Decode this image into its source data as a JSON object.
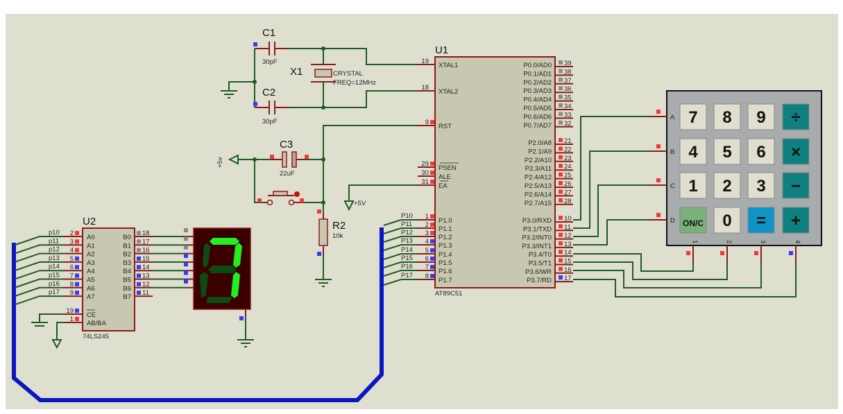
{
  "colors": {
    "background": "#dfdfd0",
    "wire": "#1f5c1f",
    "pin": "#8b1a1a",
    "bus": "#0a16c0",
    "high": "#f03a3a",
    "low": "#3a3af5",
    "float": "#8a8a8a",
    "segment_on": "#22ee22",
    "segment_off": "#0f4a12",
    "display_bg": "#3a0000"
  },
  "u1": {
    "ref": "U1",
    "part": "AT89C51",
    "left_pins": [
      {
        "name": "XTAL1",
        "num": "19",
        "state": ""
      },
      {
        "name": "XTAL2",
        "num": "18",
        "state": ""
      },
      {
        "name": "RST",
        "num": "9",
        "state": "high"
      },
      {
        "name": "PSEN",
        "num": "29",
        "state": "high"
      },
      {
        "name": "ALE",
        "num": "30",
        "state": "high"
      },
      {
        "name": "EA",
        "num": "31",
        "state": "high"
      },
      {
        "name": "P1.0",
        "num": "1",
        "state": "high",
        "net": "P10"
      },
      {
        "name": "P1.1",
        "num": "2",
        "state": "high",
        "net": "P11"
      },
      {
        "name": "P1.2",
        "num": "3",
        "state": "high",
        "net": "P12"
      },
      {
        "name": "P1.3",
        "num": "4",
        "state": "low",
        "net": "P13"
      },
      {
        "name": "P1.4",
        "num": "5",
        "state": "low",
        "net": "P14"
      },
      {
        "name": "P1.5",
        "num": "6",
        "state": "low",
        "net": "P15"
      },
      {
        "name": "P1.6",
        "num": "7",
        "state": "low",
        "net": "P16"
      },
      {
        "name": "P1.7",
        "num": "8",
        "state": "low",
        "net": "P17"
      }
    ],
    "right_pins": [
      {
        "name": "P0.0/AD0",
        "num": "39",
        "state": "float"
      },
      {
        "name": "P0.1/AD1",
        "num": "38",
        "state": "float"
      },
      {
        "name": "P0.2/AD2",
        "num": "37",
        "state": "float"
      },
      {
        "name": "P0.3/AD3",
        "num": "36",
        "state": "float"
      },
      {
        "name": "P0.4/AD4",
        "num": "35",
        "state": "float"
      },
      {
        "name": "P0.5/AD5",
        "num": "34",
        "state": "float"
      },
      {
        "name": "P0.6/AD6",
        "num": "33",
        "state": "float"
      },
      {
        "name": "P0.7/AD7",
        "num": "32",
        "state": "float"
      },
      {
        "name": "P2.0/A8",
        "num": "21",
        "state": "high"
      },
      {
        "name": "P2.1/A9",
        "num": "22",
        "state": "high"
      },
      {
        "name": "P2.2/A10",
        "num": "23",
        "state": "high"
      },
      {
        "name": "P2.3/A11",
        "num": "24",
        "state": "high"
      },
      {
        "name": "P2.4/A12",
        "num": "25",
        "state": "high"
      },
      {
        "name": "P2.5/A13",
        "num": "26",
        "state": "high"
      },
      {
        "name": "P2.6/A14",
        "num": "27",
        "state": "high"
      },
      {
        "name": "P2.7/A15",
        "num": "28",
        "state": "high"
      },
      {
        "name": "P3.0/RXD",
        "num": "10",
        "state": "high"
      },
      {
        "name": "P3.1/TXD",
        "num": "11",
        "state": "high"
      },
      {
        "name": "P3.2/INT0",
        "num": "12",
        "state": "high"
      },
      {
        "name": "P3.3/INT1",
        "num": "13",
        "state": "high"
      },
      {
        "name": "P3.4/T0",
        "num": "14",
        "state": "high"
      },
      {
        "name": "P3.5/T1",
        "num": "15",
        "state": "high"
      },
      {
        "name": "P3.6/WR",
        "num": "16",
        "state": "high"
      },
      {
        "name": "P3.7/RD",
        "num": "17",
        "state": "low"
      }
    ]
  },
  "u2": {
    "ref": "U2",
    "part": "74LS245",
    "left_pins": [
      {
        "name": "A0",
        "num": "2",
        "state": "high",
        "net": "p10"
      },
      {
        "name": "A1",
        "num": "3",
        "state": "high",
        "net": "p11"
      },
      {
        "name": "A2",
        "num": "4",
        "state": "high",
        "net": "p12"
      },
      {
        "name": "A3",
        "num": "5",
        "state": "low",
        "net": "p13"
      },
      {
        "name": "A4",
        "num": "6",
        "state": "low",
        "net": "p14"
      },
      {
        "name": "A5",
        "num": "7",
        "state": "low",
        "net": "p15"
      },
      {
        "name": "A6",
        "num": "8",
        "state": "low",
        "net": "p16"
      },
      {
        "name": "A7",
        "num": "9",
        "state": "low",
        "net": "p17"
      },
      {
        "name": "CE",
        "num": "19",
        "state": "low"
      },
      {
        "name": "AB/BA",
        "num": "1",
        "state": "high"
      }
    ],
    "right_pins": [
      {
        "name": "B0",
        "num": "18",
        "state": "float"
      },
      {
        "name": "B1",
        "num": "17",
        "state": "float"
      },
      {
        "name": "B2",
        "num": "16",
        "state": "float"
      },
      {
        "name": "B3",
        "num": "15",
        "state": "low"
      },
      {
        "name": "B4",
        "num": "14",
        "state": "low"
      },
      {
        "name": "B5",
        "num": "13",
        "state": "low"
      },
      {
        "name": "B6",
        "num": "12",
        "state": "low"
      },
      {
        "name": "B7",
        "num": "11",
        "state": "low"
      }
    ]
  },
  "display": {
    "inputs": [
      "float",
      "float",
      "float",
      "low",
      "low",
      "low",
      "low"
    ],
    "segments": {
      "a": true,
      "b": true,
      "c": true,
      "d": false,
      "e": false,
      "f": false,
      "g": false
    }
  },
  "c1": {
    "ref": "C1",
    "value": "30pF"
  },
  "c2": {
    "ref": "C2",
    "value": "30pF"
  },
  "c3": {
    "ref": "C3",
    "value": "22uF"
  },
  "x1": {
    "ref": "X1",
    "part": "CRYSTAL",
    "value": "FREQ=12MHz"
  },
  "r2": {
    "ref": "R2",
    "value": "10k"
  },
  "power": {
    "reset_supply": "+5v",
    "ea_supply": "+5V"
  },
  "keypad": {
    "rows": [
      "A",
      "B",
      "C",
      "D"
    ],
    "cols": [
      "1",
      "2",
      "3",
      "4"
    ],
    "row_states": [
      "high",
      "high",
      "high",
      "high"
    ],
    "col_states": [
      "high",
      "high",
      "high",
      "low"
    ],
    "keys": [
      "7",
      "8",
      "9",
      "÷",
      "4",
      "5",
      "6",
      "×",
      "1",
      "2",
      "3",
      "−",
      "ON/C",
      "0",
      "=",
      "+"
    ]
  }
}
